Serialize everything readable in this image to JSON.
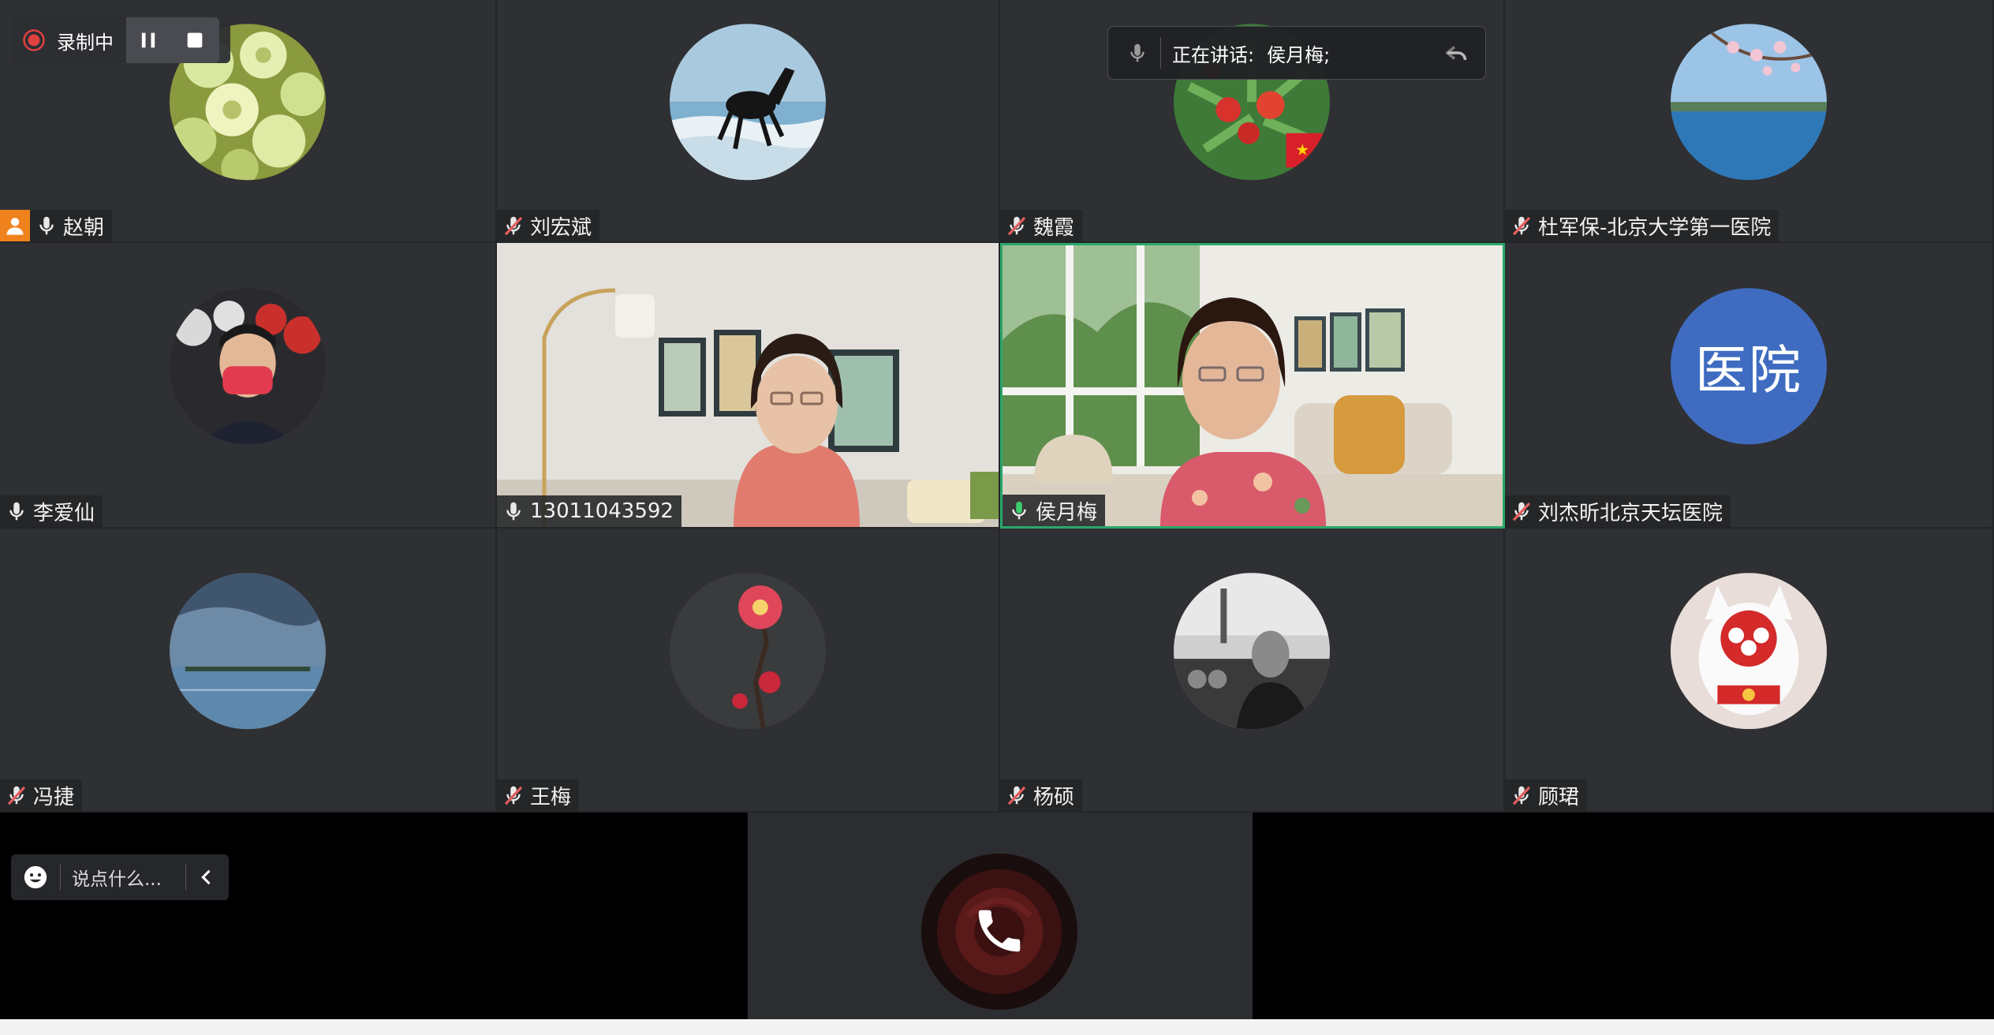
{
  "recording": {
    "label": "录制中"
  },
  "speaking": {
    "prefix": "正在讲话:",
    "name": "侯月梅;"
  },
  "chat": {
    "placeholder": "说点什么..."
  },
  "participants": [
    {
      "name": "赵朝",
      "mic": "on",
      "host": true
    },
    {
      "name": "刘宏斌",
      "mic": "muted"
    },
    {
      "name": "魏霞",
      "mic": "muted"
    },
    {
      "name": "杜军保-北京大学第一医院",
      "mic": "muted"
    },
    {
      "name": "李爱仙",
      "mic": "on"
    },
    {
      "name": "13011043592",
      "mic": "on"
    },
    {
      "name": "侯月梅",
      "mic": "speaking"
    },
    {
      "name": "刘杰昕北京天坛医院",
      "mic": "muted",
      "avatar_text": "医院"
    },
    {
      "name": "冯捷",
      "mic": "muted"
    },
    {
      "name": "王梅",
      "mic": "muted"
    },
    {
      "name": "杨硕",
      "mic": "muted"
    },
    {
      "name": "顾珺",
      "mic": "muted"
    }
  ],
  "colors": {
    "host_badge": "#f0821e",
    "speaking_border": "#29a86a",
    "avatar_blue": "#3f6cc1",
    "muted_icon": "#e25d5d"
  },
  "icons": [
    "record-icon",
    "pause-icon",
    "stop-icon",
    "mic-icon",
    "mic-muted-icon",
    "host-icon",
    "emoji-icon",
    "collapse-chevron-icon",
    "phone-icon"
  ]
}
